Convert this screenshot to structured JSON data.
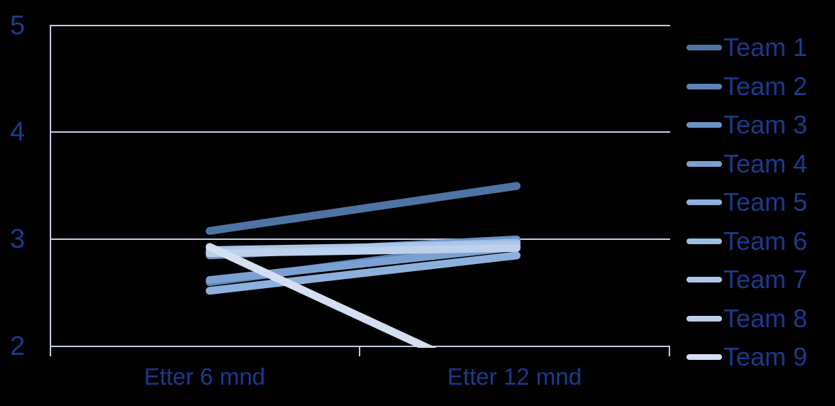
{
  "chart_data": {
    "type": "line",
    "title": "",
    "subtitle": "",
    "xlabel": "",
    "ylabel": "",
    "categories": [
      "Etter 6 mnd",
      "Etter 12 mnd"
    ],
    "x_tick_labels": [
      "Etter 6 mnd",
      "Etter 12 mnd"
    ],
    "y_tick_labels": [
      "5",
      "4",
      "3",
      "2"
    ],
    "y_ticks": [
      2,
      3,
      4,
      5
    ],
    "ylim": [
      2,
      5
    ],
    "grid": "horizontal",
    "legend_position": "right",
    "background_color": "#000000",
    "gridline_color": "#C3C8E4",
    "axis_color": "#C3C8E4",
    "tick_label_color": "#1B3A8C",
    "legend_text_color": "#1B3A8C",
    "series": [
      {
        "name": "Team 1",
        "color": "#4F74A3",
        "values": [
          3.08,
          3.5
        ]
      },
      {
        "name": "Team 2",
        "color": "#5C83B4",
        "values": [
          2.6,
          2.98
        ]
      },
      {
        "name": "Team 3",
        "color": "#6B92C4",
        "values": [
          2.85,
          3.0
        ]
      },
      {
        "name": "Team 4",
        "color": "#7BA1D2",
        "values": [
          2.62,
          2.93
        ]
      },
      {
        "name": "Team 5",
        "color": "#8DB1DC",
        "values": [
          2.52,
          2.85
        ]
      },
      {
        "name": "Team 6",
        "color": "#9DBCE2",
        "values": [
          2.88,
          2.97
        ]
      },
      {
        "name": "Team 7",
        "color": "#AAC6E8",
        "values": [
          2.9,
          2.95
        ]
      },
      {
        "name": "Team 8",
        "color": "#BDD0EC",
        "values": [
          2.87,
          2.92
        ]
      },
      {
        "name": "Team 9",
        "color": "#D4DFF2",
        "values": [
          2.93,
          1.6
        ]
      }
    ],
    "notes": "Team 9 declines steeply and exits the plot area below the y=2 axis limit between the two categories."
  },
  "legend": {
    "items": [
      {
        "label": "Team 1"
      },
      {
        "label": "Team 2"
      },
      {
        "label": "Team 3"
      },
      {
        "label": "Team 4"
      },
      {
        "label": "Team 5"
      },
      {
        "label": "Team 6"
      },
      {
        "label": "Team 7"
      },
      {
        "label": "Team 8"
      },
      {
        "label": "Team 9"
      }
    ]
  },
  "axis": {
    "y_labels": [
      "5",
      "4",
      "3",
      "2"
    ],
    "x_labels": [
      "Etter 6 mnd",
      "Etter 12 mnd"
    ]
  }
}
